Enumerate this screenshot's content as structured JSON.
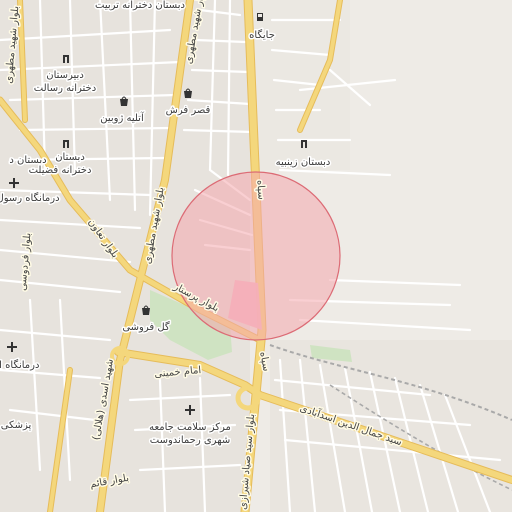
{
  "map": {
    "colors": {
      "background": "#eeebe6",
      "block": "#e4e0da",
      "street": "#ffffff",
      "major_road": "#f4d77c",
      "major_road_casing": "#e6bc5a",
      "park": "#cfe3c2",
      "highlight_zone": "#f5b8c8",
      "radius_fill": "#f4a7ad",
      "radius_stroke": "#dc6b75",
      "railway": "#a9a9a9"
    },
    "radius_circle_opacity": 0.55,
    "labels": {
      "school_tarbiat": "دبستان دخترانه تربیت",
      "blvd_shahid_motahari_top": "بلوار شهید مطهری",
      "jaygah": "جایگاه",
      "blvd_shahid_motahari_mid": "بلوار شهید مطهری",
      "dabirestan_resalat": "دبیرستان\nدخترانه رسالت",
      "atelier_zhobin": "آتلیه ژوبین",
      "qasr_farsh": "قصر فرش",
      "dabestan_d": "دبستان د",
      "dabestan_fazilat": "دبستان\nدخترانه فضیلت",
      "dabestan_zeinabieh": "دبستان زینبیه",
      "sepah_top": "سپاه",
      "darmangah_rasul": "درمانگاه رسول",
      "blvd_ferdowsi": "بلوار فردوسی",
      "blvd_taavon": "بلوار تعاون",
      "blvd_shahid_motahari_low": "بلوار شهید مطهری",
      "blvd_parastar": "بلوار پرستار",
      "gol_forushi": "گل فروشی",
      "darmangah_amam": "درمانگاه امام",
      "imam_khomeini": "امام خمینی",
      "sepah_low": "سپاه",
      "shahid_asadi_helali": "شهید اسدی (هلالی)",
      "markaz_salamat": "مرکز سلامت جامعه\nشهری رحماندوست",
      "seyed_jamal": "سید جمال الدین اسدآبادی",
      "pezeshki": "پزشکی",
      "blvd_ghaem": "بلوار قائم",
      "blvd_sayad_shirazi": "بلوار سید صیاد شیرازی"
    },
    "icons": {
      "school": "school-icon",
      "fuel": "fuel-station-icon",
      "shop": "shopping-bag-icon",
      "clinic": "medical-cross-icon"
    }
  }
}
